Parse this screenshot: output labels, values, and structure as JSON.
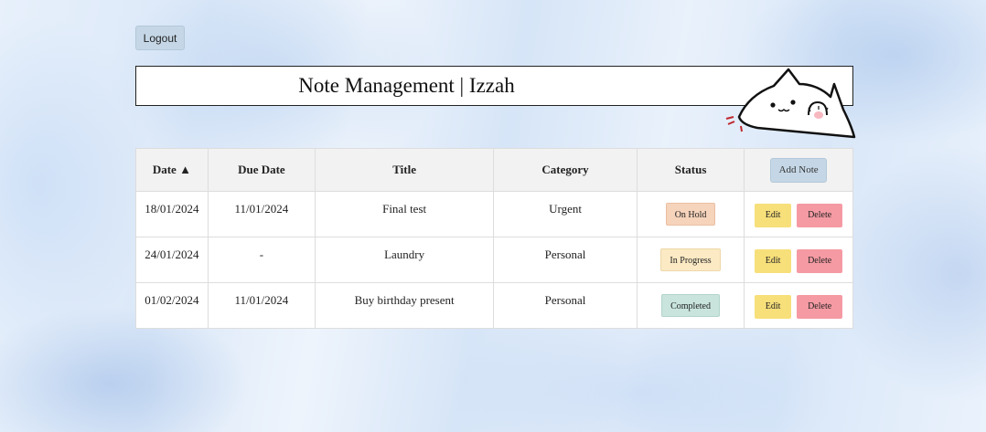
{
  "header": {
    "logout_label": "Logout",
    "title": "Note Management | Izzah"
  },
  "table": {
    "columns": [
      "Date ▲",
      "Due Date",
      "Title",
      "Category",
      "Status"
    ],
    "add_label": "Add Note",
    "edit_label": "Edit",
    "delete_label": "Delete",
    "rows": [
      {
        "date": "18/01/2024",
        "due": "11/01/2024",
        "title": "Final test",
        "category": "Urgent",
        "status": "On Hold"
      },
      {
        "date": "24/01/2024",
        "due": "-",
        "title": "Laundry",
        "category": "Personal",
        "status": "In Progress"
      },
      {
        "date": "01/02/2024",
        "due": "11/01/2024",
        "title": "Buy birthday present",
        "category": "Personal",
        "status": "Completed"
      }
    ]
  },
  "colors": {
    "button_blue": "#c5d7e6",
    "status_on_hold": "#f6d3bb",
    "status_in_progress": "#fbeac4",
    "status_completed": "#c8e4dd",
    "edit": "#f7df7a",
    "delete": "#f59aa3"
  },
  "decorations": {
    "mascot": "peeking-cat-illustration"
  }
}
